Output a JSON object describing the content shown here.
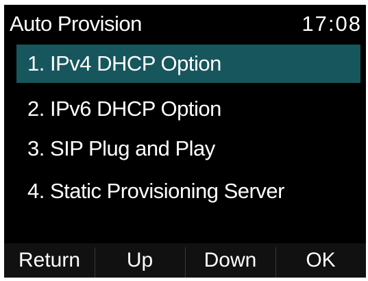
{
  "header": {
    "title": "Auto Provision",
    "time": "17:08"
  },
  "menu": {
    "selected_index": 0,
    "items": [
      {
        "label": "1. IPv4 DHCP Option"
      },
      {
        "label": "2. IPv6 DHCP Option"
      },
      {
        "label": "3. SIP Plug and Play"
      },
      {
        "label": "4. Static Provisioning Server"
      }
    ]
  },
  "softkeys": {
    "return_label": "Return",
    "up_label": "Up",
    "down_label": "Down",
    "ok_label": "OK"
  },
  "colors": {
    "background": "#000000",
    "selection": "#17565c",
    "text": "#ffffff"
  }
}
